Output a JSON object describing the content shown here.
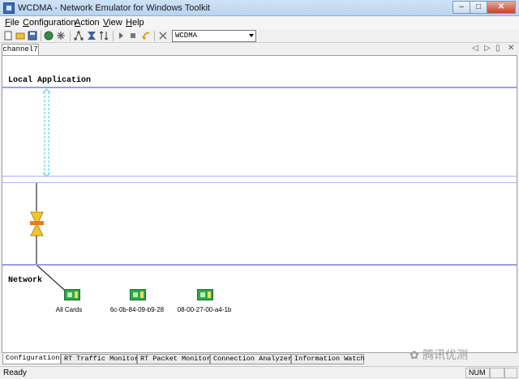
{
  "window": {
    "title": "WCDMA - Network Emulator for Windows Toolkit",
    "minimize_glyph": "–",
    "maximize_glyph": "□",
    "close_glyph": "✕"
  },
  "menu": [
    "File",
    "Configuration",
    "Action",
    "View",
    "Help"
  ],
  "toolbar": {
    "dropdown_value": "WCDMA",
    "icons": [
      "new-icon",
      "open-icon",
      "save-icon",
      "globe-icon",
      "settings-icon",
      "network-icon",
      "filter-icon",
      "sort-icon",
      "play-icon",
      "stop-icon",
      "pause-icon",
      "close-icon"
    ]
  },
  "doc_tab": {
    "label": "channel7"
  },
  "canvas": {
    "local_label": "Local Application",
    "network_label": "Network",
    "cards": [
      {
        "label": "All Cards"
      },
      {
        "label": "6c-0b-84-09-b9-28"
      },
      {
        "label": "08-00-27-00-a4-1b"
      }
    ]
  },
  "bottom_tabs": [
    "Configuration",
    "RT Traffic Monitor",
    "RT Packet Monitor",
    "Connection Analyzer",
    "Information Watch"
  ],
  "status": {
    "text": "Ready",
    "num": "NUM"
  },
  "watermark": "腾讯优测"
}
